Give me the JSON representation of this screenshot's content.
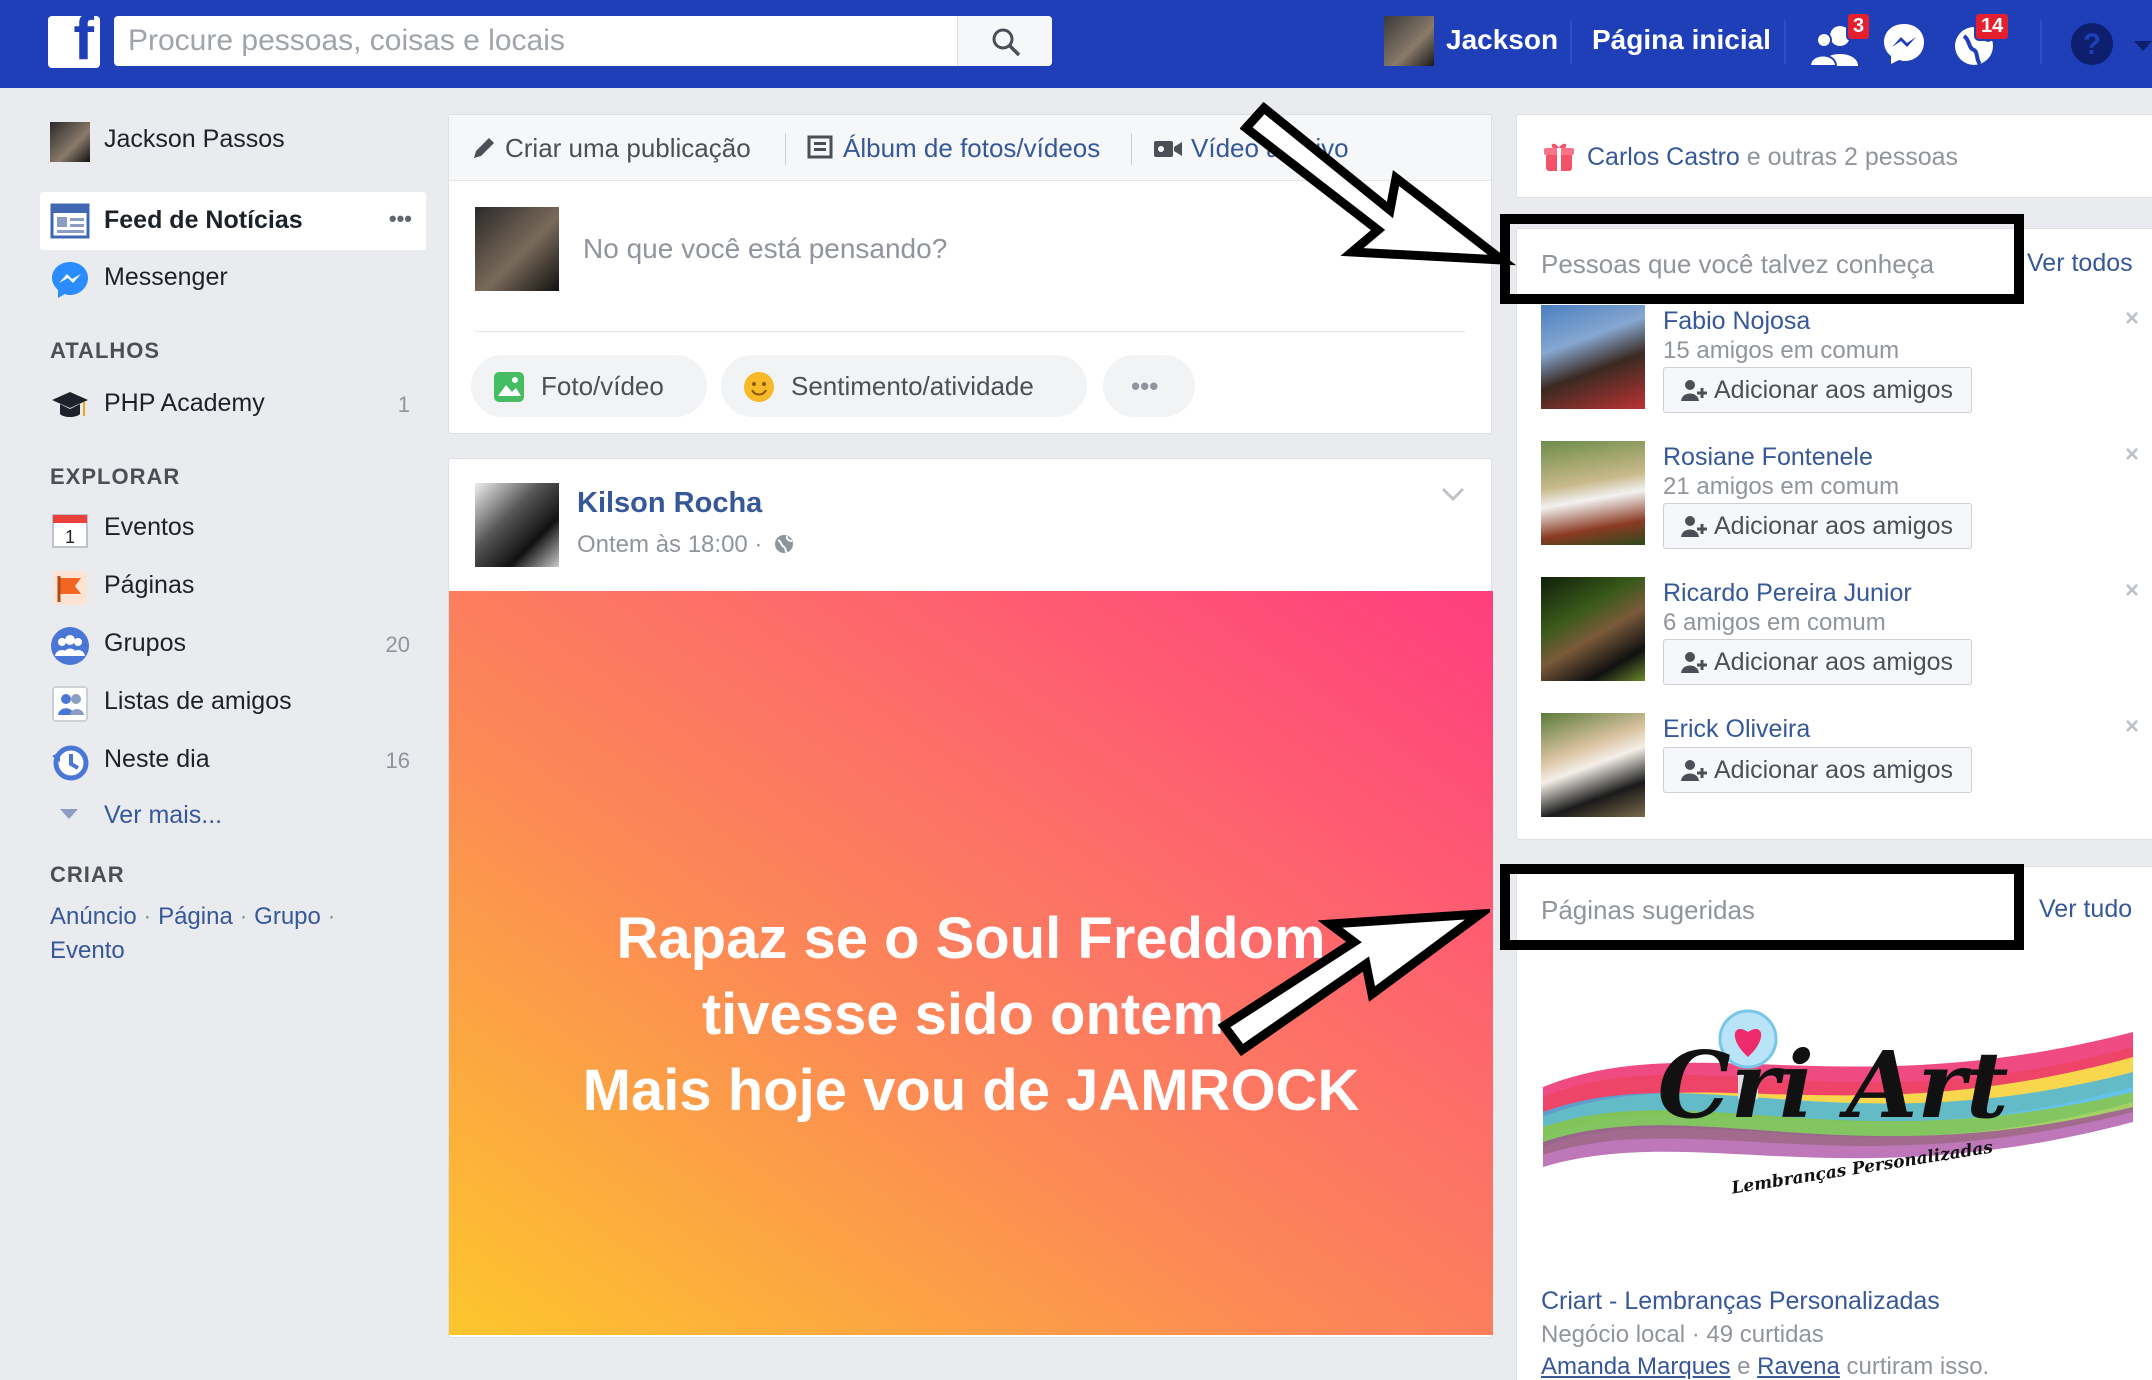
{
  "topbar": {
    "logo": "f",
    "search_placeholder": "Procure pessoas, coisas e locais",
    "user_name": "Jackson",
    "home_label": "Página inicial",
    "friend_requests_count": "3",
    "notifications_count": "14",
    "brand_color": "#1f3fb8"
  },
  "left_nav": {
    "profile_name": "Jackson Passos",
    "feed_label": "Feed de Notícias",
    "feed_more": "•••",
    "messenger_label": "Messenger",
    "shortcuts_heading": "ATALHOS",
    "shortcuts": [
      {
        "label": "PHP Academy",
        "count": "1",
        "icon": "graduation-cap-icon"
      }
    ],
    "explore_heading": "EXPLORAR",
    "explore": [
      {
        "label": "Eventos",
        "count": "",
        "icon": "calendar-icon"
      },
      {
        "label": "Páginas",
        "count": "",
        "icon": "flag-icon"
      },
      {
        "label": "Grupos",
        "count": "20",
        "icon": "groups-icon"
      },
      {
        "label": "Listas de amigos",
        "count": "",
        "icon": "friend-list-icon"
      },
      {
        "label": "Neste dia",
        "count": "16",
        "icon": "clock-history-icon"
      }
    ],
    "see_more": "Ver mais...",
    "create_heading": "CRIAR",
    "create_links": [
      "Anúncio",
      "Página",
      "Grupo",
      "Evento"
    ],
    "create_sep": "·"
  },
  "composer": {
    "tab_create": "Criar uma publicação",
    "tab_album": "Álbum de fotos/vídeos",
    "tab_live": "Vídeo ao vivo",
    "prompt": "No que você está pensando?",
    "btn_photo": "Foto/vídeo",
    "btn_feeling": "Sentimento/atividade",
    "btn_more": "•••"
  },
  "post": {
    "author": "Kilson Rocha",
    "time": "Ontem às 18:00 ·",
    "text": "Rapaz se o Soul Freddom\ntivesse sido ontem.\nMais hoje vou de JAMROCK"
  },
  "right": {
    "birthday_name": "Carlos Castro",
    "birthday_rest": " e outras 2 pessoas",
    "pymk_title": "Pessoas que você talvez conheça",
    "pymk_see_all": "Ver todos",
    "add_label": "Adicionar aos amigos",
    "dismiss": "×",
    "people": [
      {
        "name": "Fabio Nojosa",
        "mutual": "15 amigos em comum"
      },
      {
        "name": "Rosiane Fontenele",
        "mutual": "21 amigos em comum"
      },
      {
        "name": "Ricardo Pereira Junior",
        "mutual": "6 amigos em comum"
      },
      {
        "name": "Erick Oliveira",
        "mutual": ""
      }
    ],
    "pages_title": "Páginas sugeridas",
    "pages_see_all": "Ver tudo",
    "page_logo_text": "Cri Art",
    "page_logo_sub": "Lembranças Personalizadas",
    "page_name": "Criart - Lembranças Personalizadas",
    "page_meta": "Negócio local · 49 curtidas",
    "page_likers": "Amanda Marques",
    "page_likers_sep": " e ",
    "page_likers2": "Ravena",
    "page_likers_rest": " curtiram isso."
  }
}
